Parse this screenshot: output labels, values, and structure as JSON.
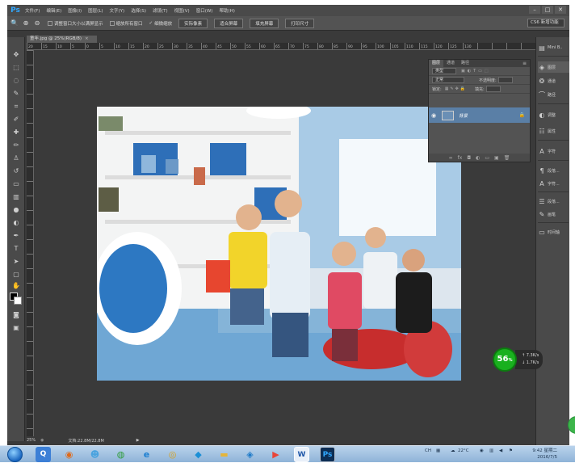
{
  "app": {
    "logo": "Ps",
    "menus": [
      "文件(F)",
      "编辑(E)",
      "图像(I)",
      "图层(L)",
      "文字(Y)",
      "选择(S)",
      "滤镜(T)",
      "视图(V)",
      "窗口(W)",
      "帮助(H)"
    ],
    "window_controls": [
      "–",
      "□",
      "✕"
    ]
  },
  "options_bar": {
    "checkbox_resize": "调整窗口大小以满屏显示",
    "checkbox_zoom_all": "缩放所有窗口",
    "checkbox_scrubby": "细微缩放",
    "btn_actual": "实际像素",
    "btn_fit": "适合屏幕",
    "btn_fill": "填充屏幕",
    "btn_print": "打印尺寸",
    "workspace": "CS6 新增功能"
  },
  "document": {
    "tab_title": "童年.jpg @ 25%(RGB/8)",
    "ruler_labels": [
      "20",
      "15",
      "10",
      "5",
      "0",
      "5",
      "10",
      "15",
      "20",
      "25",
      "30",
      "35",
      "40",
      "45",
      "50",
      "55",
      "60",
      "65",
      "70",
      "75",
      "80",
      "85",
      "90",
      "95",
      "100",
      "105",
      "110",
      "115",
      "120",
      "125",
      "130"
    ]
  },
  "layers_panel": {
    "tabs": [
      "图层",
      "通道",
      "路径"
    ],
    "filter_label": "类型",
    "blend_mode": "正常",
    "opacity_label": "不透明度:",
    "lock_label": "锁定:",
    "fill_label": "填充:",
    "layer_name": "背景"
  },
  "right_dock": {
    "top_label": "Mini B..",
    "items": [
      "图层",
      "通道",
      "路径",
      "调整",
      "属性",
      "字符",
      "段落...",
      "字符...",
      "段落...",
      "画笔",
      "时间轴"
    ]
  },
  "status": {
    "zoom": "25%",
    "doc_info": "文档:22.8M/22.8M"
  },
  "net_monitor": {
    "percent": "56",
    "percent_unit": "%",
    "up": "7.3K/s",
    "down": "1.7K/s",
    "color": "#19b01e"
  },
  "taskbar": {
    "tray_lang": "CH",
    "tray_temp": "22°C",
    "clock_time": "9:42 星期二",
    "clock_date": "2016/7/5",
    "ps_icon": "Ps",
    "word_icon": "W"
  }
}
